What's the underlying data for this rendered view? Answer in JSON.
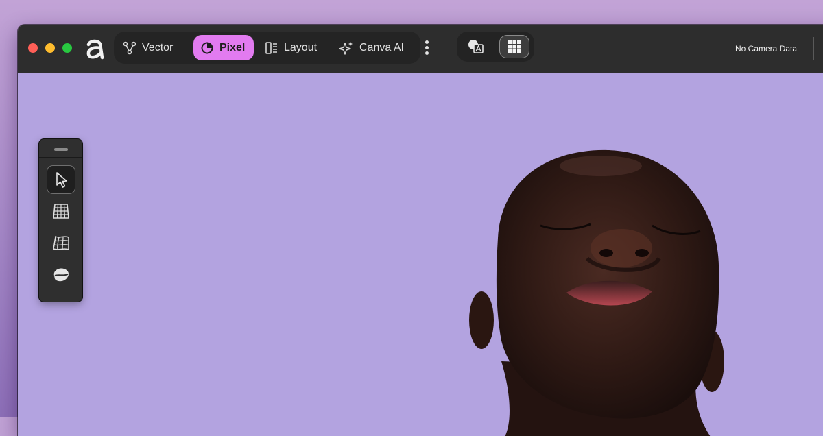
{
  "titlebar": {
    "app_logo_icon": "affinity-a-logo",
    "traffic_lights": {
      "close": "#ff5f57",
      "minimize": "#febc2e",
      "maximize": "#28c840"
    },
    "persona_tabs": [
      {
        "label": "Vector",
        "icon": "vector-pen-icon"
      },
      {
        "label": "Pixel",
        "icon": "pixel-persona-icon",
        "active": true
      },
      {
        "label": "Layout",
        "icon": "layout-icon"
      },
      {
        "label": "Canva AI",
        "icon": "sparkle-icon"
      }
    ],
    "more_icon": "vertical-ellipsis-icon",
    "camera_status": "No Camera Data"
  },
  "colors": {
    "active_tab": "#e27bf0",
    "toolbar_bg": "#2d2d2d",
    "canvas_bg": "#b3a3e0"
  },
  "tools": [
    {
      "name": "move-tool",
      "icon": "cursor-arrow-icon",
      "selected": true
    },
    {
      "name": "mesh-warp-tool",
      "icon": "grid-mesh-icon"
    },
    {
      "name": "perspective-tool",
      "icon": "warp-grid-icon"
    },
    {
      "name": "liquify-tool",
      "icon": "liquify-blob-icon"
    }
  ]
}
